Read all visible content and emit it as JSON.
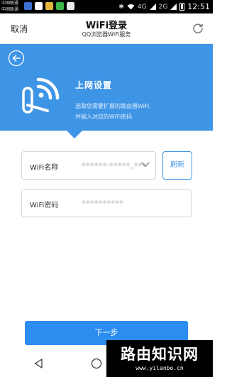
{
  "status_bar": {
    "carrier_1": "中国联通",
    "carrier_2": "中国联通",
    "signal_labels": [
      "4G",
      "2G"
    ],
    "time": "12:51"
  },
  "header": {
    "cancel_label": "取消",
    "title": "WiFi登录",
    "subtitle": "QQ浏览器WiFi服务"
  },
  "banner": {
    "title": "上网设置",
    "desc_line1": "选取您需要扩展的路由器WiFi,",
    "desc_line2": "并输入对应的WiFi密码"
  },
  "form": {
    "ssid_label": "WiFi名称",
    "ssid_value": "••••••-•••••_•••",
    "refresh_label": "刷新",
    "password_label": "WiFi密码",
    "password_value": "••••••••••"
  },
  "next_label": "下一步",
  "watermark": {
    "title": "路由知识网",
    "url": "www.yilanbo.cn"
  },
  "colors": {
    "accent": "#3e95e6",
    "button": "#2c8df0"
  }
}
